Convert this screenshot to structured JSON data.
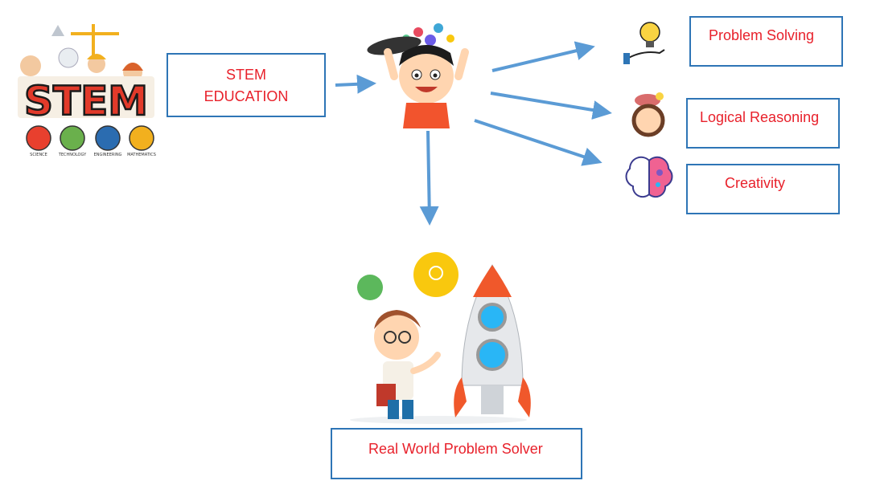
{
  "boxes": {
    "stem": {
      "line1": "STEM",
      "line2": "EDUCATION"
    },
    "problem_solving": "Problem Solving",
    "logical_reasoning": "Logical Reasoning",
    "creativity": "Creativity",
    "real_world": "Real World Problem Solver"
  },
  "stem_logo": {
    "letters": "STEM",
    "subjects": [
      "SCIENCE",
      "TECHNOLOGY",
      "ENGINEERING",
      "MATHEMATICS"
    ]
  },
  "colors": {
    "box_border": "#2e75b6",
    "label_text": "#e8212b",
    "arrow": "#5b9bd5"
  }
}
